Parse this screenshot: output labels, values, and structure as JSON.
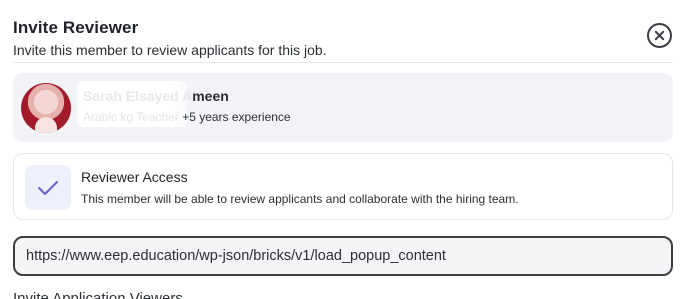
{
  "modal": {
    "title": "Invite Reviewer",
    "subtitle": "Invite this member to review applicants for this job."
  },
  "member": {
    "name_prefix": "Sarah Elsayed A",
    "name_suffix": "meen",
    "role": "Arabic kg Teacher",
    "experience": "+5 years experience"
  },
  "access": {
    "title": "Reviewer Access",
    "description": "This member will be able to review applicants and collaborate with the hiring team.",
    "accent_color": "#6b5fd8"
  },
  "url_field": {
    "value": "https://www.eep.education/wp-json/bricks/v1/load_popup_content"
  },
  "next_section": {
    "heading": "Invite Application Viewers"
  }
}
